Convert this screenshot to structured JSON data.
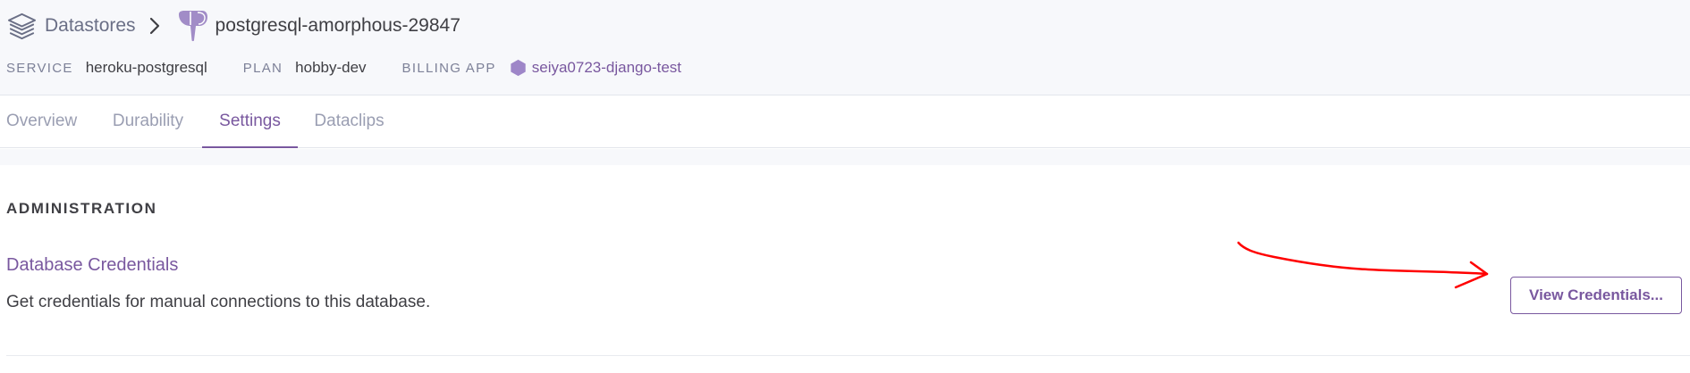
{
  "breadcrumb": {
    "root_label": "Datastores",
    "database_name": "postgresql-amorphous-29847",
    "root_icon": "layers-stack-icon",
    "separator_icon": "chevron-right-icon",
    "database_icon": "postgres-elephant-icon"
  },
  "meta": {
    "service_label": "SERVICE",
    "service_value": "heroku-postgresql",
    "plan_label": "PLAN",
    "plan_value": "hobby-dev",
    "billing_label": "BILLING APP",
    "billing_app_icon": "app-hexagon-icon",
    "billing_app_value": "seiya0723-django-test"
  },
  "tabs": [
    {
      "label": "Overview",
      "active": false
    },
    {
      "label": "Durability",
      "active": false
    },
    {
      "label": "Settings",
      "active": true
    },
    {
      "label": "Dataclips",
      "active": false
    }
  ],
  "administration": {
    "heading": "ADMINISTRATION",
    "credentials_title": "Database Credentials",
    "credentials_description": "Get credentials for manual connections to this database.",
    "view_button_label": "View Credentials..."
  },
  "colors": {
    "accent": "#79589f",
    "header_bg": "#f7f8fb",
    "text": "#3f3f44",
    "muted": "#9a9eb2",
    "annotation": "#ff0000"
  }
}
